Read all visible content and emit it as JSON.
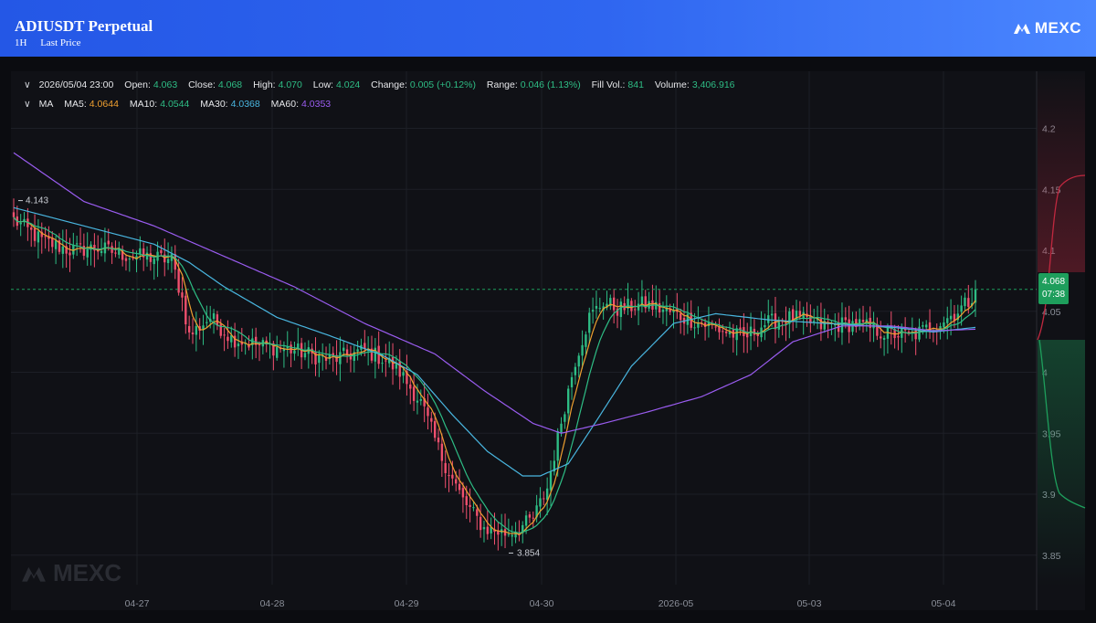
{
  "header": {
    "title": "ADIUSDT Perpetual",
    "interval": "1H",
    "price_type": "Last Price",
    "brand": "MEXC"
  },
  "info_bar": {
    "datetime": "2026/05/04 23:00",
    "open_label": "Open:",
    "open": "4.063",
    "close_label": "Close:",
    "close": "4.068",
    "high_label": "High:",
    "high": "4.070",
    "low_label": "Low:",
    "low": "4.024",
    "change_label": "Change:",
    "change": "0.005 (+0.12%)",
    "range_label": "Range:",
    "range": "0.046 (1.13%)",
    "fillvol_label": "Fill Vol.:",
    "fillvol": "841",
    "volume_label": "Volume:",
    "volume": "3,406.916"
  },
  "ma_bar": {
    "label": "MA",
    "ma5_label": "MA5:",
    "ma5": "4.0644",
    "ma10_label": "MA10:",
    "ma10": "4.0544",
    "ma30_label": "MA30:",
    "ma30": "4.0368",
    "ma60_label": "MA60:",
    "ma60": "4.0353"
  },
  "last_price": {
    "price": "4.068",
    "countdown": "07:38"
  },
  "watermark": "MEXC",
  "colors": {
    "up": "#2ebd85",
    "down": "#f0506e",
    "ma5": "#f0a030",
    "ma10": "#2ebd85",
    "ma30": "#49b6e0",
    "ma60": "#9a5cf0"
  },
  "chart_data": {
    "type": "candlestick",
    "title": "ADIUSDT Perpetual",
    "x_ticks": [
      "04-27",
      "04-28",
      "04-29",
      "04-30",
      "2026-05",
      "05-03",
      "05-04"
    ],
    "y_ticks": [
      "4.2",
      "4.15",
      "4.1",
      "4.05",
      "4",
      "3.95",
      "3.9",
      "3.85"
    ],
    "ylim": [
      3.825,
      4.25
    ],
    "grid": true,
    "annotations": {
      "max_label": "4.143",
      "min_label": "3.854"
    },
    "close_path": [
      [
        0,
        4.125
      ],
      [
        8,
        4.108
      ],
      [
        16,
        4.1
      ],
      [
        24,
        4.102
      ],
      [
        32,
        4.096
      ],
      [
        40,
        4.094
      ],
      [
        45,
        4.092
      ],
      [
        48,
        4.06
      ],
      [
        50,
        4.03
      ],
      [
        56,
        4.045
      ],
      [
        62,
        4.028
      ],
      [
        70,
        4.022
      ],
      [
        80,
        4.018
      ],
      [
        90,
        4.01
      ],
      [
        100,
        4.018
      ],
      [
        106,
        4.01
      ],
      [
        110,
        4.0
      ],
      [
        116,
        3.975
      ],
      [
        122,
        3.93
      ],
      [
        128,
        3.895
      ],
      [
        134,
        3.872
      ],
      [
        140,
        3.868
      ],
      [
        144,
        3.872
      ],
      [
        148,
        3.88
      ],
      [
        152,
        3.905
      ],
      [
        156,
        3.96
      ],
      [
        160,
        4.01
      ],
      [
        164,
        4.045
      ],
      [
        168,
        4.058
      ],
      [
        172,
        4.052
      ],
      [
        180,
        4.056
      ],
      [
        188,
        4.048
      ],
      [
        196,
        4.04
      ],
      [
        204,
        4.032
      ],
      [
        208,
        4.028
      ],
      [
        214,
        4.04
      ],
      [
        222,
        4.045
      ],
      [
        230,
        4.038
      ],
      [
        240,
        4.04
      ],
      [
        248,
        4.032
      ],
      [
        256,
        4.03
      ],
      [
        262,
        4.038
      ],
      [
        268,
        4.048
      ],
      [
        272,
        4.058
      ],
      [
        274,
        4.068
      ]
    ],
    "ma60_path": [
      [
        0,
        4.18
      ],
      [
        20,
        4.14
      ],
      [
        40,
        4.12
      ],
      [
        60,
        4.095
      ],
      [
        80,
        4.07
      ],
      [
        100,
        4.04
      ],
      [
        120,
        4.015
      ],
      [
        134,
        3.985
      ],
      [
        148,
        3.958
      ],
      [
        156,
        3.95
      ],
      [
        168,
        3.958
      ],
      [
        180,
        3.967
      ],
      [
        196,
        3.98
      ],
      [
        210,
        3.998
      ],
      [
        222,
        4.025
      ],
      [
        236,
        4.038
      ],
      [
        250,
        4.038
      ],
      [
        262,
        4.034
      ],
      [
        274,
        4.0353
      ]
    ],
    "ma30_path": [
      [
        0,
        4.135
      ],
      [
        20,
        4.12
      ],
      [
        40,
        4.105
      ],
      [
        50,
        4.09
      ],
      [
        60,
        4.07
      ],
      [
        75,
        4.045
      ],
      [
        90,
        4.03
      ],
      [
        105,
        4.014
      ],
      [
        115,
        3.998
      ],
      [
        125,
        3.965
      ],
      [
        135,
        3.935
      ],
      [
        145,
        3.915
      ],
      [
        150,
        3.915
      ],
      [
        158,
        3.925
      ],
      [
        166,
        3.96
      ],
      [
        176,
        4.005
      ],
      [
        188,
        4.04
      ],
      [
        200,
        4.048
      ],
      [
        215,
        4.043
      ],
      [
        232,
        4.04
      ],
      [
        250,
        4.037
      ],
      [
        262,
        4.033
      ],
      [
        274,
        4.0368
      ]
    ]
  }
}
